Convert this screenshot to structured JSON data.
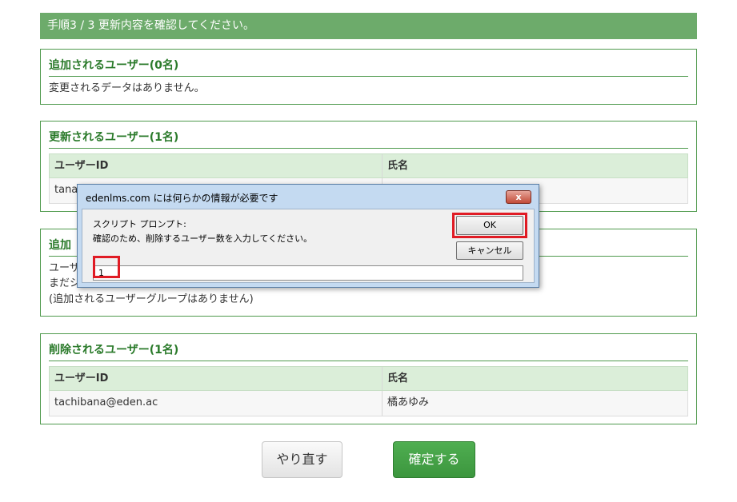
{
  "step_header": "手順3 / 3 更新内容を確認してください。",
  "added_users": {
    "title": "追加されるユーザー(0名)",
    "message": "変更されるデータはありません。"
  },
  "updated_users": {
    "title": "更新されるユーザー(1名)",
    "columns": [
      "ユーザーID",
      "氏名"
    ],
    "rows": [
      {
        "id": "tanal",
        "name": ""
      }
    ]
  },
  "added_groups": {
    "title": "追加",
    "line1": "ユーザ",
    "line2": "まだシ",
    "line3": "(追加されるユーザーグループはありません)"
  },
  "deleted_users": {
    "title": "削除されるユーザー(1名)",
    "columns": [
      "ユーザーID",
      "氏名"
    ],
    "rows": [
      {
        "id": "tachibana@eden.ac",
        "name": "橘あゆみ"
      }
    ]
  },
  "buttons": {
    "redo": "やり直す",
    "confirm": "確定する"
  },
  "dialog": {
    "title": "edenlms.com には何らかの情報が必要です",
    "close": "x",
    "prompt_label": "スクリプト プロンプト:",
    "message": "確認のため、削除するユーザー数を入力してください。",
    "ok": "OK",
    "cancel": "キャンセル",
    "input_value": "1"
  },
  "colors": {
    "header_green": "#6dab6b",
    "title_green": "#2a7a2a",
    "confirm_green": "#45a247",
    "highlight_red": "#e01b24"
  }
}
